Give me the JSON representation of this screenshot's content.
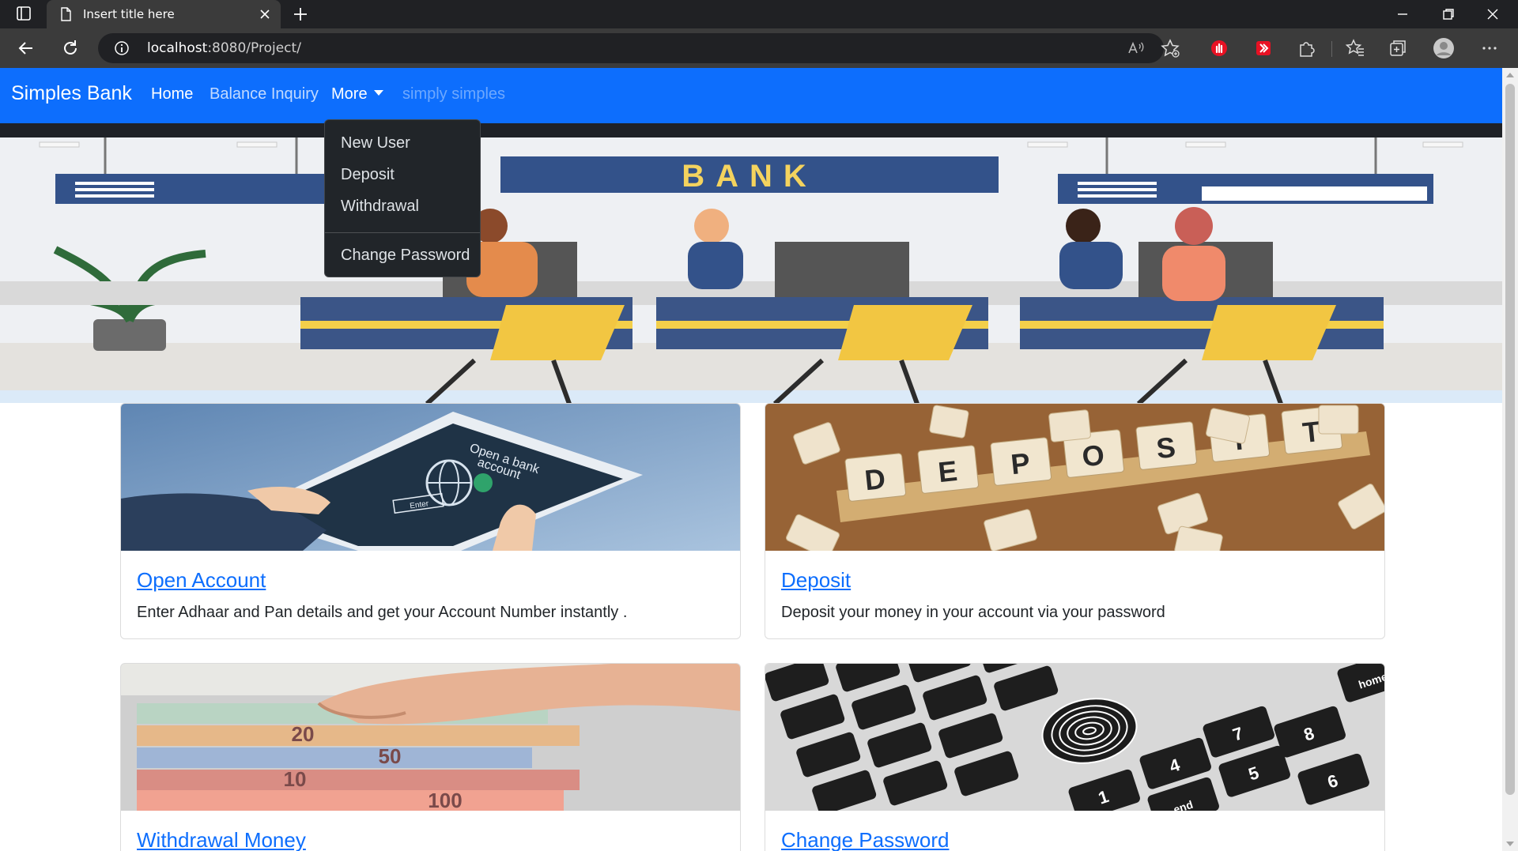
{
  "browser": {
    "tab_title": "Insert title here",
    "url_host": "localhost",
    "url_rest": ":8080/Project/"
  },
  "navbar": {
    "brand": "Simples Bank",
    "links": {
      "home": "Home",
      "balance": "Balance Inquiry",
      "more": "More",
      "disabled": "simply simples"
    }
  },
  "dropdown": {
    "items": [
      "New User",
      "Deposit",
      "Withdrawal",
      "Change Password"
    ]
  },
  "hero": {
    "sign": "BANK"
  },
  "cards": [
    {
      "title": "Open Account",
      "text": "Enter Adhaar and Pan details and get your Account Number instantly .",
      "image_text_1": "Open a bank",
      "image_text_2": "account",
      "image_button": "Enter"
    },
    {
      "title": "Deposit",
      "text": "Deposit your money in your account via your password",
      "image_tiles": [
        "D",
        "E",
        "P",
        "O",
        "S",
        "I",
        "T"
      ]
    },
    {
      "title": "Withdrawal Money",
      "text": "",
      "image_notes": [
        "20",
        "50",
        "10",
        "100"
      ]
    },
    {
      "title": "Change Password",
      "text": "",
      "image_keys": [
        "home",
        "7",
        "8",
        "4",
        "5",
        "6",
        "1",
        "end"
      ]
    }
  ],
  "colors": {
    "primary": "#0d6efd",
    "dropdown_bg": "#212529"
  }
}
